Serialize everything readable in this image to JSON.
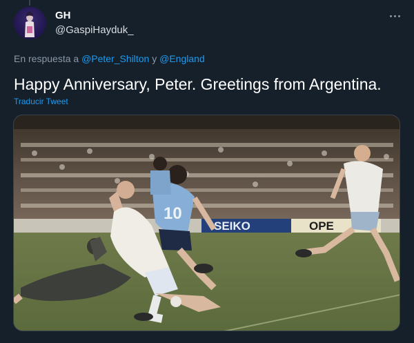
{
  "tweet": {
    "author": {
      "display_name": "GH",
      "handle": "@GaspiHayduk_",
      "avatar_icon": "avatar-photo"
    },
    "more_icon": "more-horizontal-icon",
    "reply": {
      "prefix": "En respuesta a",
      "mention_1": "@Peter_Shilton",
      "connector": "y",
      "mention_2": "@England"
    },
    "text": "Happy Anniversary, Peter. Greetings from Argentina.",
    "translate_label": "Traducir Tweet",
    "media": {
      "type": "photo",
      "board_text_1": "SEIKO",
      "board_text_2": "OPE",
      "shirt_number": "10"
    }
  },
  "colors": {
    "background": "#15202b",
    "primary_text": "#ffffff",
    "secondary_text": "#8b98a5",
    "link": "#1d9bf0"
  }
}
